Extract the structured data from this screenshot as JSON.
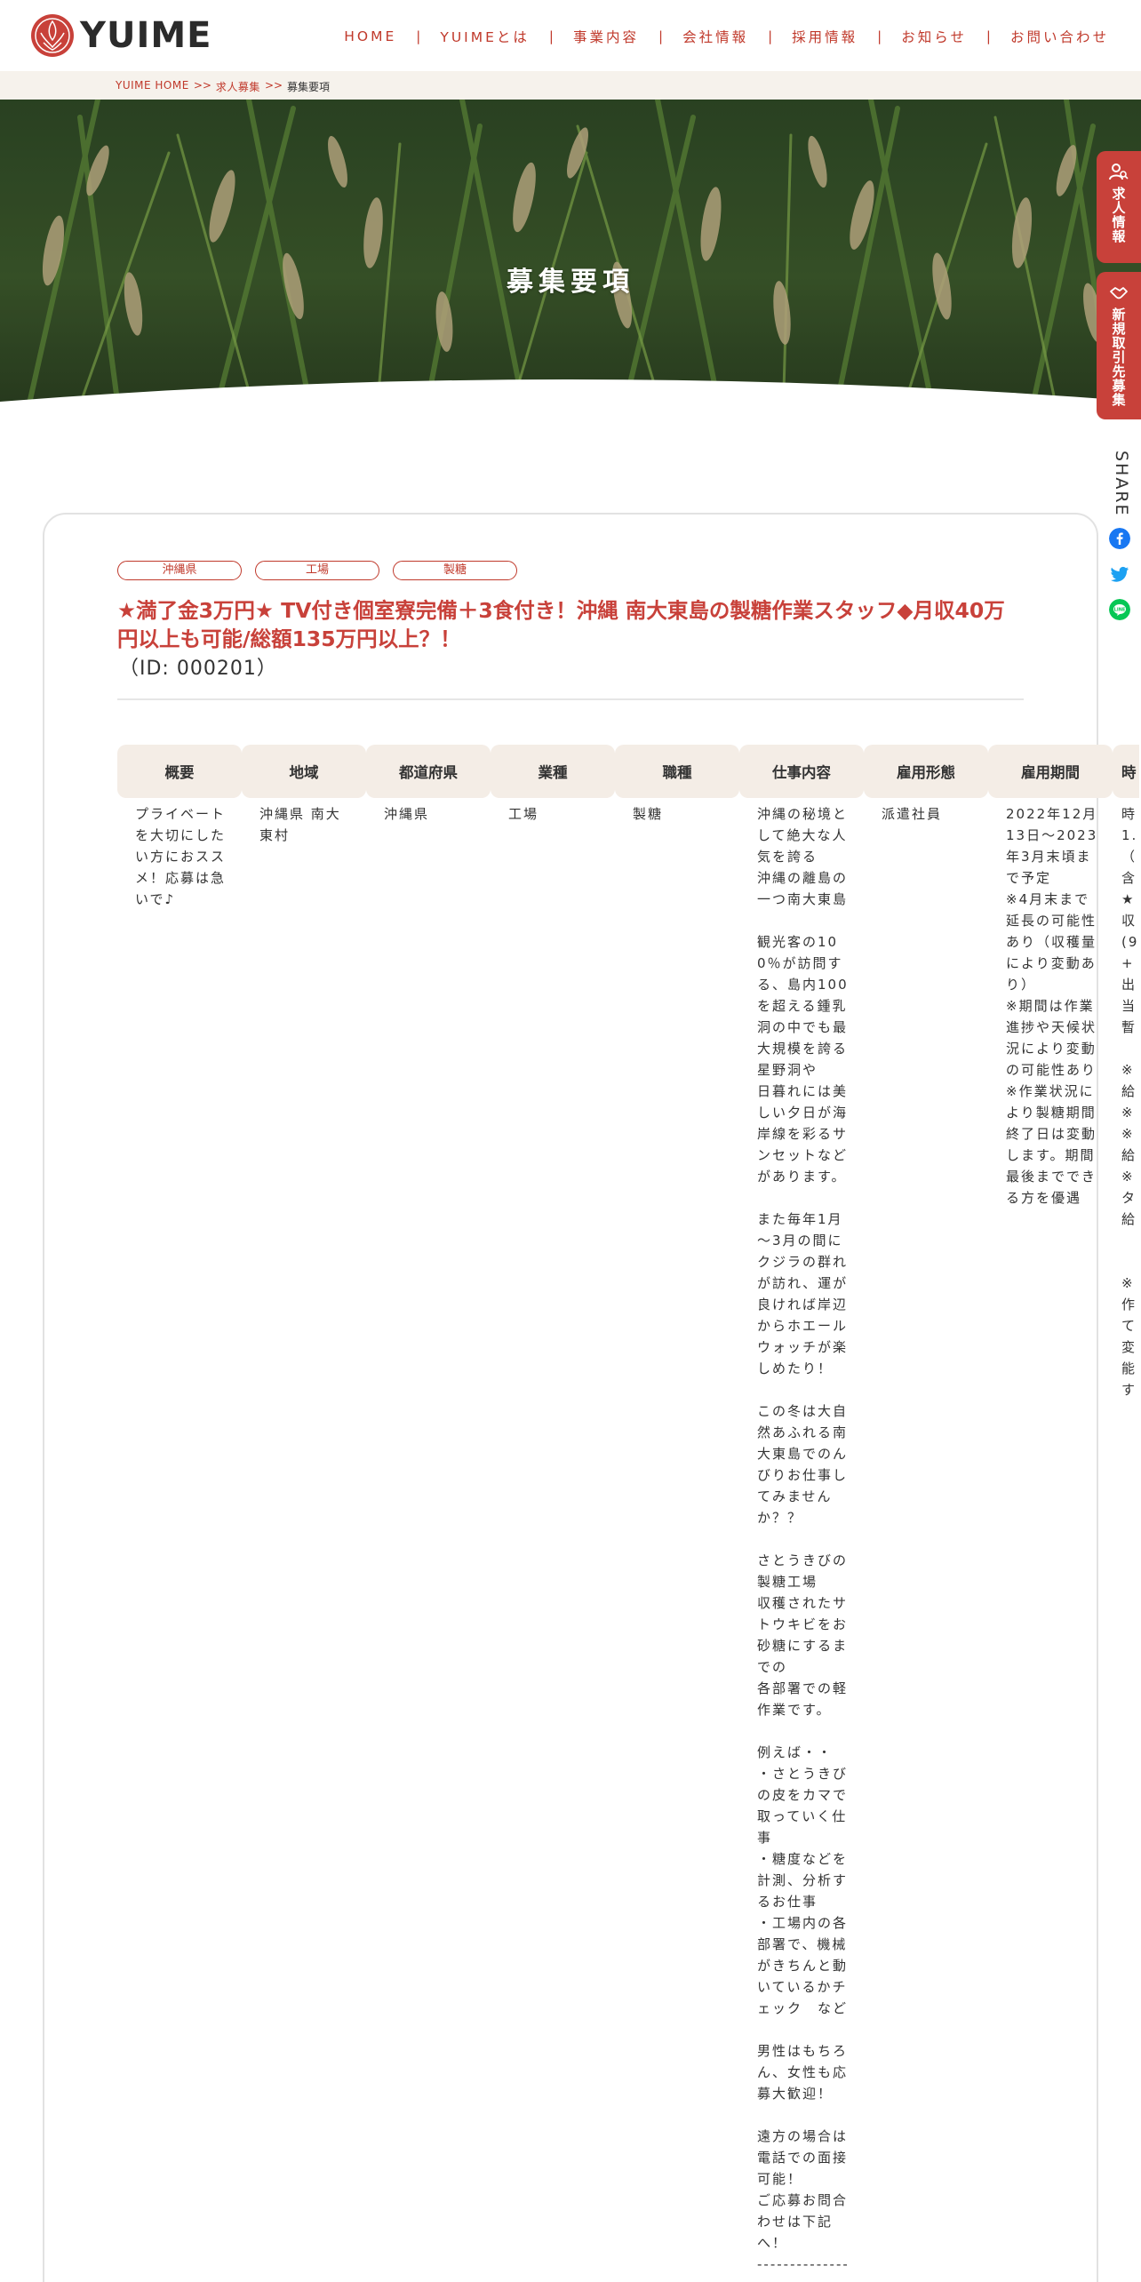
{
  "header": {
    "logo_text": "YUIME",
    "nav": [
      "HOME",
      "YUIMEとは",
      "事業内容",
      "会社情報",
      "採用情報",
      "お知らせ",
      "お問い合わせ"
    ],
    "nav_separator": "|"
  },
  "breadcrumb": {
    "items": [
      "YUIME HOME",
      "求人募集",
      "募集要項"
    ],
    "separator": ">>"
  },
  "hero": {
    "title": "募集要項"
  },
  "side_tabs": [
    {
      "label": "求人情報",
      "icon": "person-search-icon"
    },
    {
      "label": "新規取引先募集",
      "icon": "handshake-icon"
    }
  ],
  "share": {
    "label": "SHARE",
    "icons": [
      "facebook-icon",
      "twitter-icon",
      "line-icon"
    ]
  },
  "job": {
    "tags": [
      "沖縄県",
      "工場",
      "製糖"
    ],
    "title": "★満了金3万円★ TV付き個室寮完備＋3食付き！沖縄 南大東島の製糖作業スタッフ◆月収40万円以上も可能/総額135万円以上？！",
    "id": "（ID: 000201）"
  },
  "table": {
    "headers": [
      "概要",
      "地域",
      "都道府県",
      "業種",
      "職種",
      "仕事内容",
      "雇用形態",
      "雇用期間",
      "時"
    ],
    "row": [
      "プライベートを大切にしたい方におススメ！応募は急いで♪",
      "沖縄県 南大東村",
      "沖縄県",
      "工場",
      "製糖",
      "沖縄の秘境として絶大な人気を誇る\n沖縄の離島の一つ南大東島\n\n観光客の100％が訪問する、島内100を超える鍾乳洞の中でも最大規模を誇る星野洞や\n日暮れには美しい夕日が海岸線を彩るサンセットなどがあります。\n\nまた毎年1月～3月の間にクジラの群れが訪れ、運が良ければ岸辺からホエールウォッチが楽しめたり！\n\nこの冬は大自然あふれる南大東島でのんびりお仕事してみませんか？？\n\nさとうきびの製糖工場\n収穫されたサトウキビをお砂糖にするまでの\n各部署での軽作業です。\n\n例えば・・\n・さとうきびの皮をカマで取っていく仕事\n・糖度などを計測、分析するお仕事\n・工場内の各部署で、機械がきちんと動いているかチェック　など\n\n男性はもちろん、女性も応募大歓迎！\n\n遠方の場合は電話での面接可能！\nご応募お問合わせは下記へ！\n-----------------",
      "派遣社員",
      "2022年12月13日～2023年3月末頃まで予定\n※4月末まで延長の可能性あり（収穫量により変動あり）\n※期間は作業進捗や天候状況により変動の可能性あり\n※作業状況により製糖期間終了日は変動します。期間最後までできる方を優遇",
      "時\n1.\n（\n含\n★\n収\n(9\n+\n出\n当\n暫\n\n※\n給\n※\n※\n給\n※\nタ\n給\n\n\n※\n作\nて\n変\n能\nす"
    ]
  },
  "colors": {
    "accent": "#c0392b",
    "tab_red": "#c8413a",
    "breadcrumb_bg": "#f6f2ec",
    "table_header_bg": "#f4ede6"
  }
}
